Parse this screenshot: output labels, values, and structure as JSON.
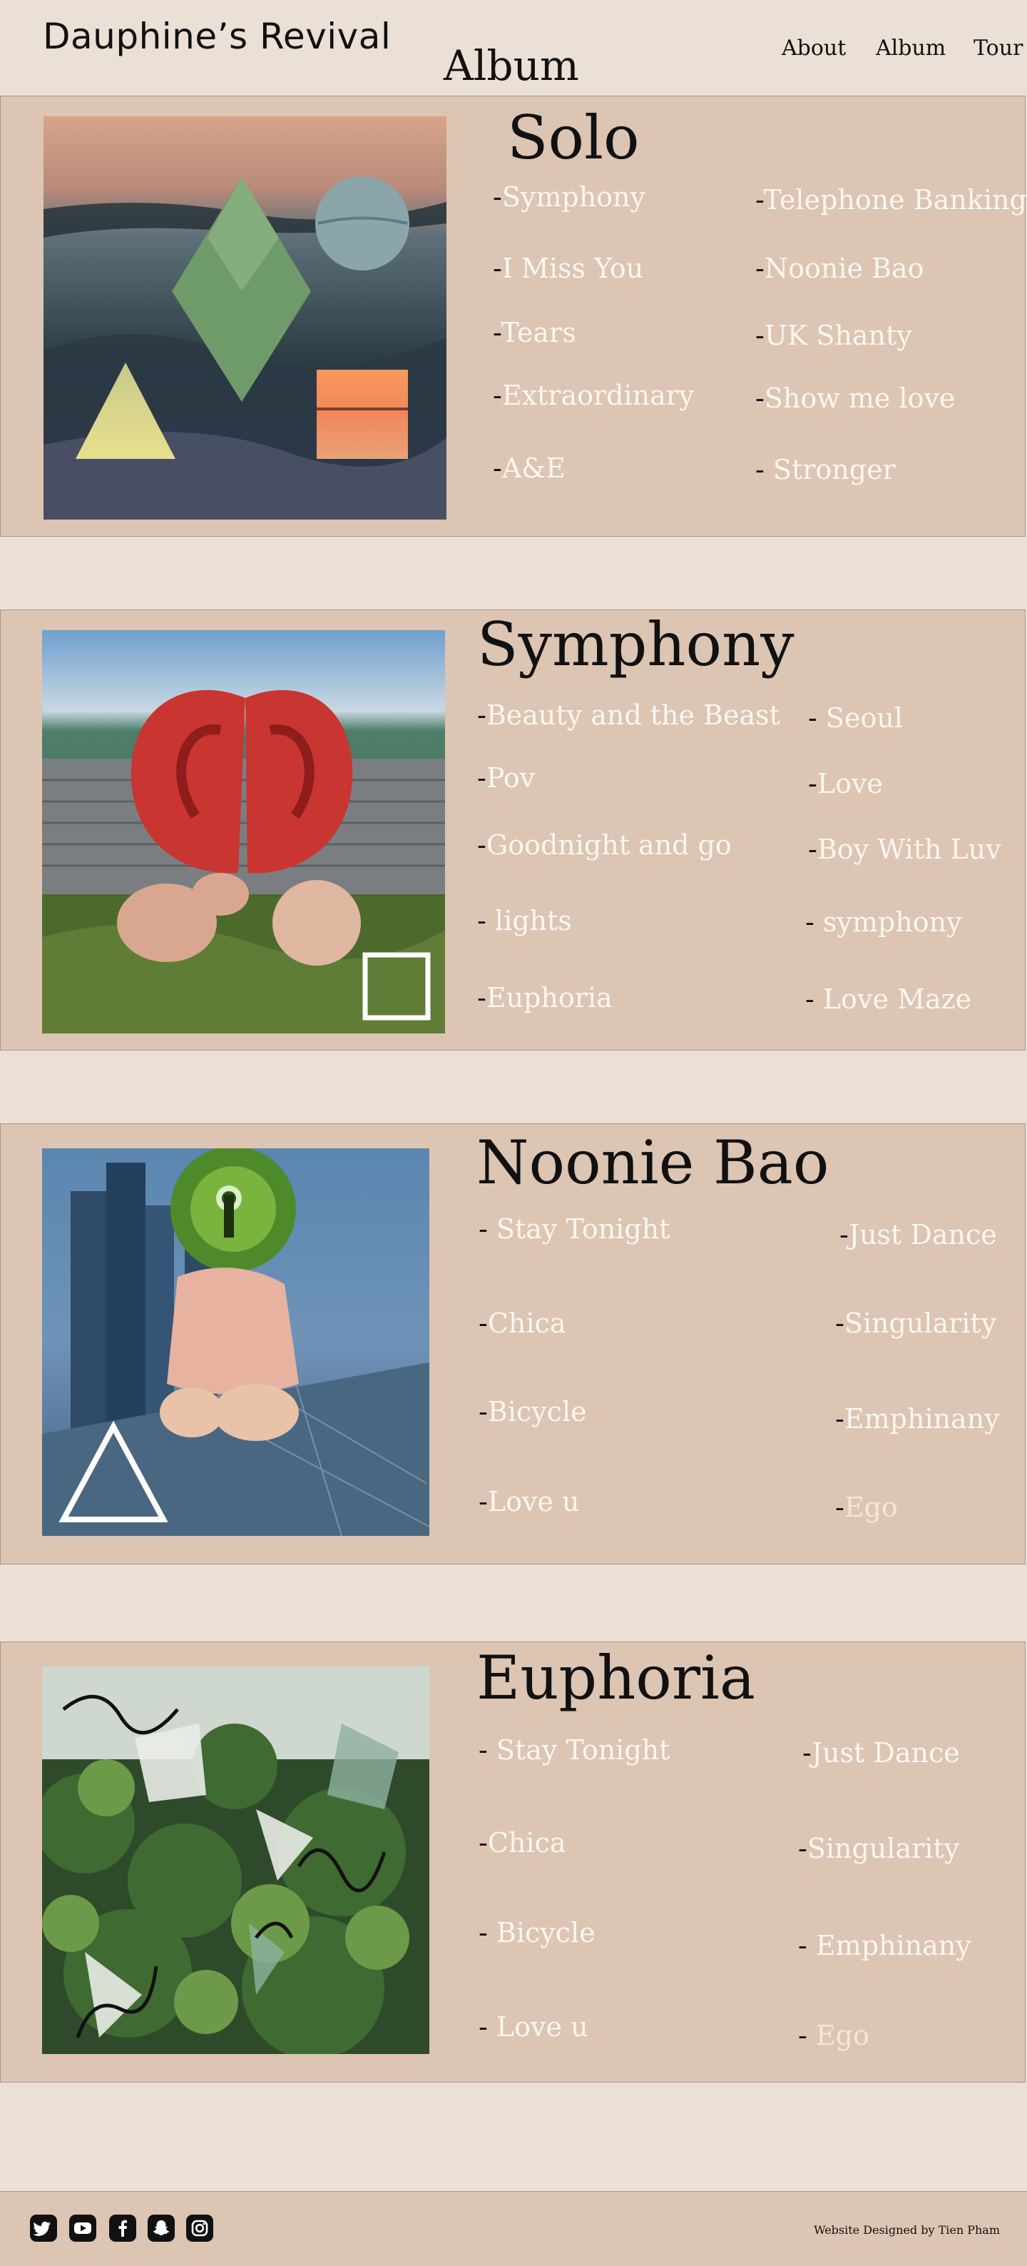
{
  "header": {
    "brand": "Dauphine’s Revival",
    "page_title": "Album",
    "nav": [
      {
        "label": "About"
      },
      {
        "label": "Album"
      },
      {
        "label": "Tour"
      }
    ]
  },
  "albums": [
    {
      "title": "Solo",
      "tracks_left": [
        "Symphony",
        "I Miss You",
        "Tears",
        "Extraordinary",
        "A&E"
      ],
      "tracks_right": [
        "Telephone Banking",
        "Noonie Bao",
        "UK Shanty",
        "Show me love",
        "Stronger"
      ]
    },
    {
      "title": "Symphony",
      "tracks_left": [
        "Beauty and the Beast",
        "Pov",
        "Goodnight and go",
        "lights",
        "Euphoria"
      ],
      "tracks_right": [
        "Seoul",
        "Love",
        "Boy With Luv",
        "symphony",
        "Love Maze"
      ]
    },
    {
      "title": "Noonie Bao",
      "tracks_left": [
        "Stay Tonight",
        "Chica",
        "Bicycle",
        "Love u"
      ],
      "tracks_right": [
        "Just Dance",
        "Singularity",
        "Emphinany",
        "Ego"
      ]
    },
    {
      "title": "Euphoria",
      "tracks_left": [
        "Stay Tonight",
        "Chica",
        "Bicycle",
        "Love u"
      ],
      "tracks_right": [
        "Just Dance",
        "Singularity",
        "Emphinany",
        "Ego"
      ]
    }
  ],
  "footer": {
    "icons": [
      "twitter-icon",
      "youtube-icon",
      "facebook-icon",
      "snapchat-icon",
      "instagram-icon"
    ],
    "credit": "Website Designed by Tien Pham"
  },
  "colors": {
    "page_background": "#ebe0d6",
    "panel_background": "#dcc5b3",
    "track_text": "#fbf6f1",
    "heading_text": "#111111"
  }
}
